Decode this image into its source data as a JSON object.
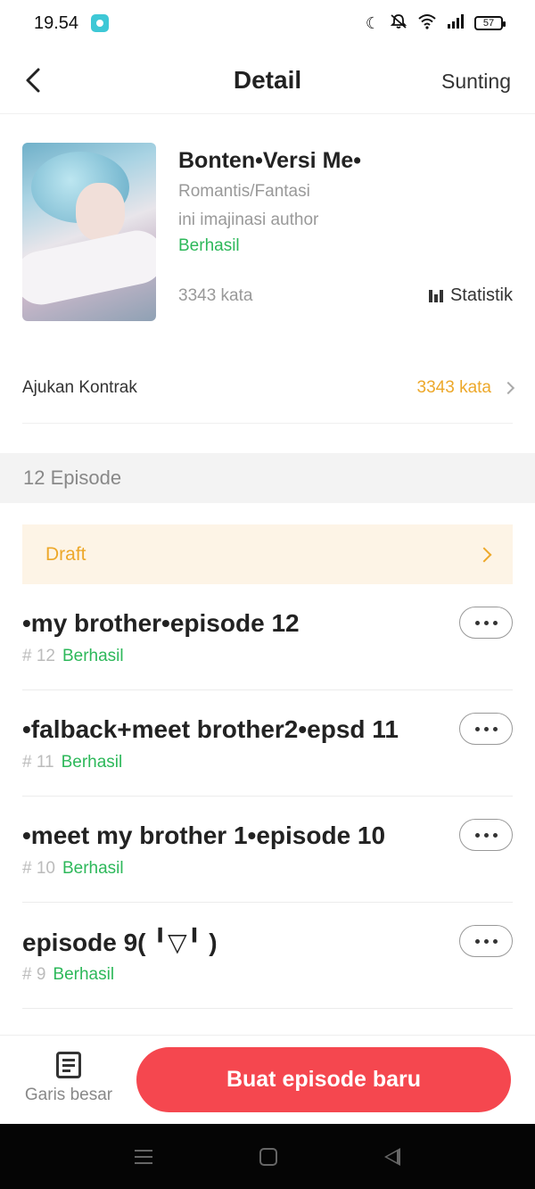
{
  "status_bar": {
    "time": "19.54",
    "battery": "57",
    "icons": [
      "moon-icon",
      "vibrate-off-icon",
      "wifi-icon",
      "signal-icon",
      "battery-icon"
    ]
  },
  "header": {
    "title": "Detail",
    "edit_label": "Sunting",
    "back_icon": "chevron-left-icon"
  },
  "book": {
    "title": "Bonten•Versi Me•",
    "genre": "Romantis/Fantasi",
    "description": "ini imajinasi author",
    "status": "Berhasil",
    "word_count": "3343 kata",
    "stats_label": "Statistik"
  },
  "contract": {
    "label": "Ajukan Kontrak",
    "value": "3343 kata"
  },
  "episodes": {
    "header": "12 Episode",
    "draft_label": "Draft",
    "items": [
      {
        "title": "•my brother•episode 12",
        "number": "# 12",
        "status": "Berhasil"
      },
      {
        "title": "•falback+meet brother2•epsd 11",
        "number": "# 11",
        "status": "Berhasil"
      },
      {
        "title": "•meet my brother 1•episode 10",
        "number": "# 10",
        "status": "Berhasil"
      },
      {
        "title": "episode 9( ╹▽╹ )",
        "number": "# 9",
        "status": "Berhasil"
      }
    ]
  },
  "bottom_bar": {
    "outline_label": "Garis besar",
    "new_episode_label": "Buat episode baru"
  },
  "colors": {
    "accent_red": "#f5474f",
    "success_green": "#2db85a",
    "draft_orange": "#eda82a",
    "draft_bg": "#fdf4e6"
  }
}
